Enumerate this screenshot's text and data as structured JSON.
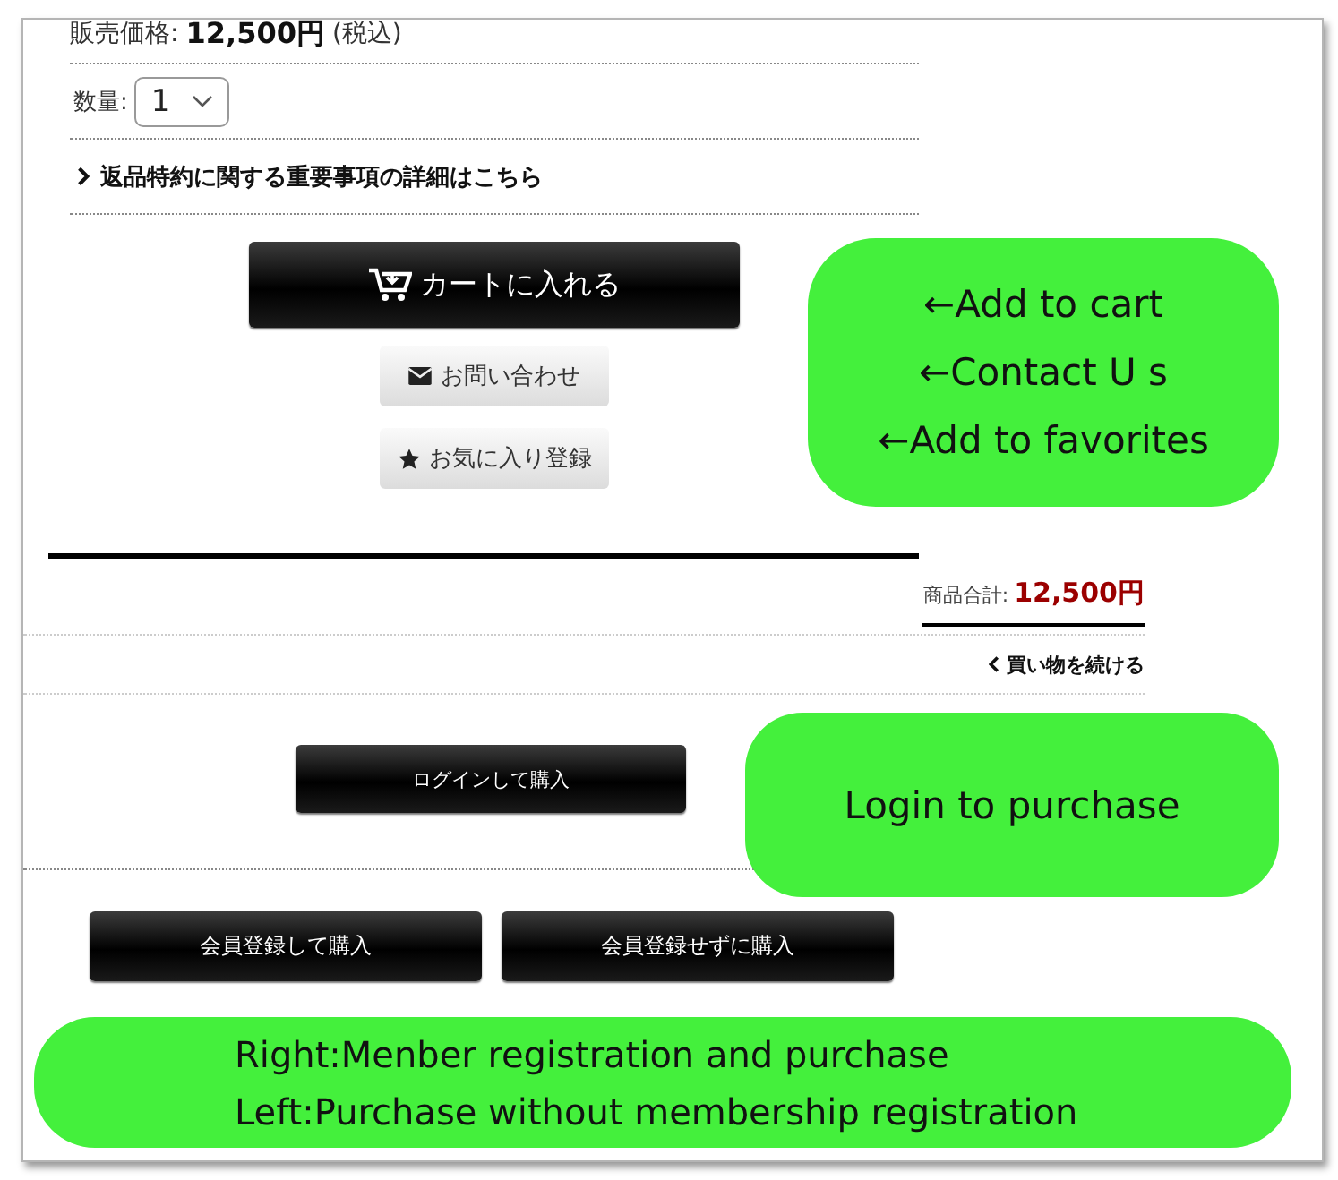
{
  "product": {
    "price_label": "販売価格:",
    "price": "12,500円",
    "tax_note": "(税込)",
    "quantity_label": "数量:",
    "quantity": "1",
    "notice_link": "返品特約に関する重要事項の詳細はこちら",
    "buttons": [
      {
        "kind": "cart",
        "label": "カートに入れる"
      },
      {
        "kind": "contact",
        "label": "お問い合わせ"
      },
      {
        "kind": "favorite",
        "label": "お気に入り登録"
      }
    ]
  },
  "cart": {
    "subtotal_label": "商品合計:",
    "subtotal": "12,500円",
    "continue_link": "買い物を続ける",
    "login_button": "ログインして購入",
    "register_buttons": [
      "会員登録して購入",
      "会員登録せずに購入"
    ]
  },
  "annotations": [
    {
      "kind": "list",
      "lines": [
        "←Add to cart",
        "←Contact U s",
        "←Add to favorites"
      ]
    },
    {
      "kind": "login",
      "lines": [
        "Login to purchase"
      ]
    },
    {
      "kind": "register",
      "lines": [
        "Right:Menber registration and purchase",
        "Left:Purchase without membership registration"
      ]
    }
  ]
}
